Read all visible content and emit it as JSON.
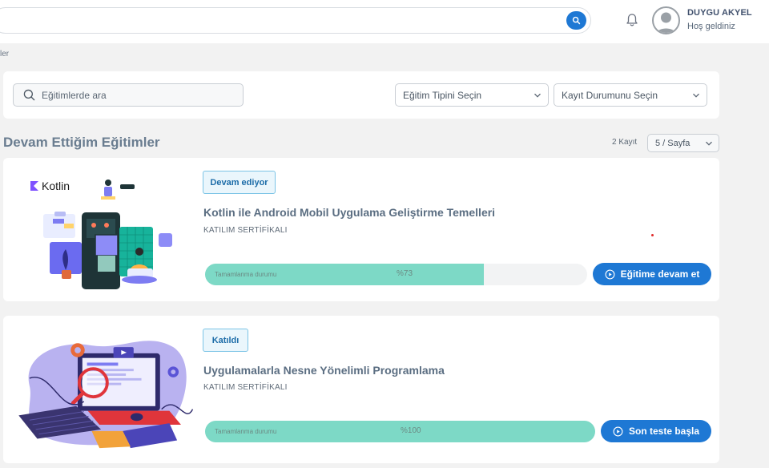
{
  "header": {
    "user_name": "DUYGU AKYEL",
    "greeting": "Hoş geldiniz",
    "icons": {
      "search": "search-icon",
      "bell": "bell-icon",
      "avatar": "user-avatar-icon"
    }
  },
  "breadcrumb": "ler",
  "filters": {
    "search_placeholder": "Eğitimlerde ara",
    "type_select": "Eğitim Tipini Seçin",
    "status_select": "Kayıt Durumunu Seçin"
  },
  "section": {
    "title": "Devam Ettiğim Eğitimler",
    "record_count": "2 Kayıt",
    "page_size": "5 / Sayfa"
  },
  "courses": [
    {
      "status": "Devam ediyor",
      "logo_text": "Kotlin",
      "title": "Kotlin ile Android Mobil Uygulama Geliştirme Temelleri",
      "subtitle": "KATILIM SERTİFİKALI",
      "progress_label": "Tamamlanma durumu",
      "progress_text": "%73",
      "progress": 73,
      "action": "Eğitime devam et"
    },
    {
      "status": "Katıldı",
      "title": "Uygulamalarla Nesne Yönelimli Programlama",
      "subtitle": "KATILIM SERTİFİKALI",
      "progress_label": "Tamamlanma durumu",
      "progress_text": "%100",
      "progress": 100,
      "action": "Son teste başla"
    }
  ],
  "colors": {
    "accent": "#1e78d4",
    "progress": "#7dd9c6",
    "badge_border": "#7cc4e6"
  }
}
